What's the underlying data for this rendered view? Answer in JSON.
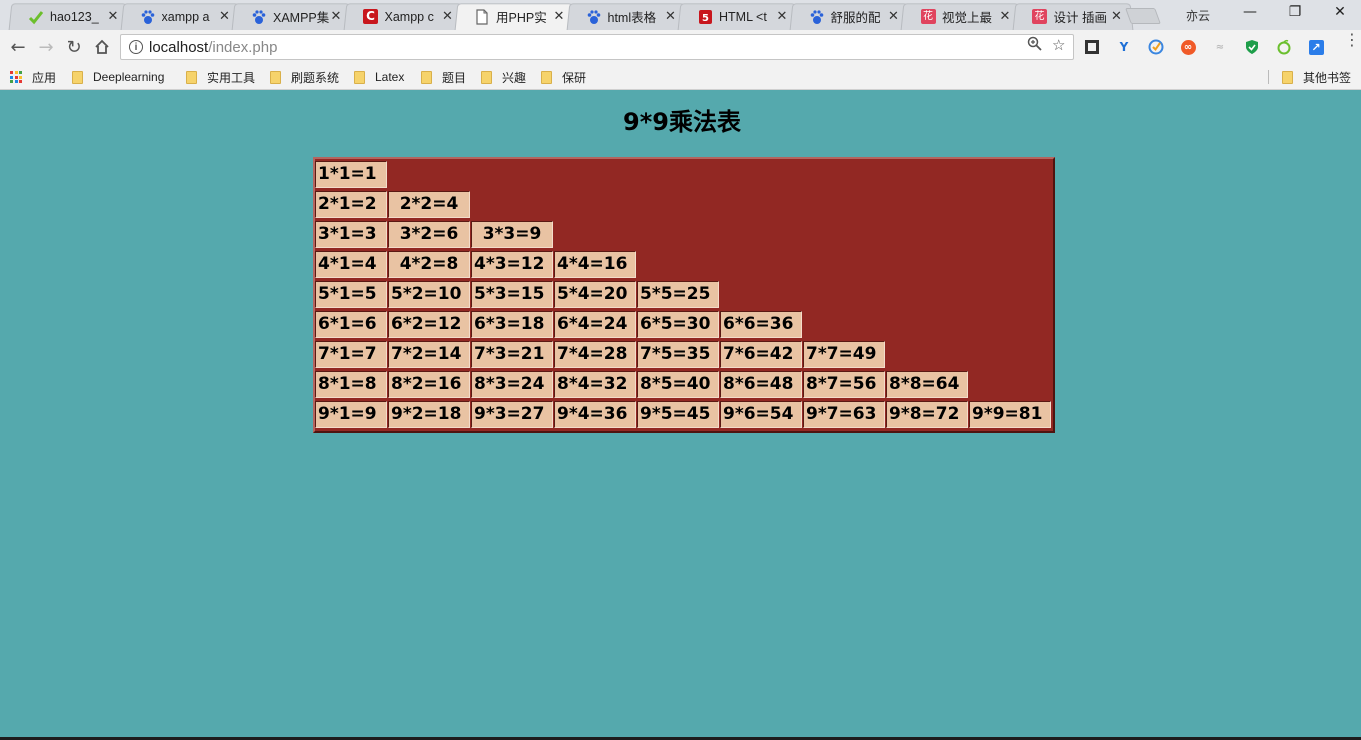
{
  "browser": {
    "tabs": [
      {
        "title": "hao123_",
        "icon": "hao123-icon",
        "active": false
      },
      {
        "title": "xampp a",
        "icon": "baidu-paw-icon",
        "active": false
      },
      {
        "title": "XAMPP集",
        "icon": "baidu-paw-icon",
        "active": false
      },
      {
        "title": "Xampp c",
        "icon": "c-logo-icon",
        "active": false
      },
      {
        "title": "用PHP实",
        "icon": "page-icon",
        "active": true
      },
      {
        "title": "html表格",
        "icon": "baidu-paw-icon",
        "active": false
      },
      {
        "title": "HTML <t",
        "icon": "html-shield-icon",
        "active": false
      },
      {
        "title": "舒服的配",
        "icon": "baidu-paw-icon",
        "active": false
      },
      {
        "title": "视觉上最",
        "icon": "huaban-icon",
        "active": false
      },
      {
        "title": "设计 插画",
        "icon": "huaban-icon",
        "active": false
      }
    ],
    "close_glyph": "✕",
    "profile_name": "亦云",
    "window_controls": {
      "minimize": "—",
      "restore": "❐",
      "close": "✕"
    },
    "address": {
      "host": "localhost",
      "path": "/index.php"
    },
    "bookmarks": [
      {
        "label": "应用",
        "icon": "apps-grid-icon"
      },
      {
        "label": "Deeplearning",
        "icon": "folder-icon"
      },
      {
        "label": "实用工具",
        "icon": "folder-icon"
      },
      {
        "label": "刷题系统",
        "icon": "folder-icon"
      },
      {
        "label": "Latex",
        "icon": "folder-icon"
      },
      {
        "label": "题目",
        "icon": "folder-icon"
      },
      {
        "label": "兴趣",
        "icon": "folder-icon"
      },
      {
        "label": "保研",
        "icon": "folder-icon"
      }
    ],
    "other_bookmarks": "其他书签",
    "colors": {
      "page_bg": "#55a9ad",
      "table_bg": "#922823",
      "cell_bg": "#e9c3a3"
    }
  },
  "page": {
    "title": "9*9乘法表",
    "rows": [
      [
        "1*1=1"
      ],
      [
        "2*1=2",
        "2*2=4"
      ],
      [
        "3*1=3",
        "3*2=6",
        "3*3=9"
      ],
      [
        "4*1=4",
        "4*2=8",
        "4*3=12",
        "4*4=16"
      ],
      [
        "5*1=5",
        "5*2=10",
        "5*3=15",
        "5*4=20",
        "5*5=25"
      ],
      [
        "6*1=6",
        "6*2=12",
        "6*3=18",
        "6*4=24",
        "6*5=30",
        "6*6=36"
      ],
      [
        "7*1=7",
        "7*2=14",
        "7*3=21",
        "7*4=28",
        "7*5=35",
        "7*6=42",
        "7*7=49"
      ],
      [
        "8*1=8",
        "8*2=16",
        "8*3=24",
        "8*4=32",
        "8*5=40",
        "8*6=48",
        "8*7=56",
        "8*8=64"
      ],
      [
        "9*1=9",
        "9*2=18",
        "9*3=27",
        "9*4=36",
        "9*5=45",
        "9*6=54",
        "9*7=63",
        "9*8=72",
        "9*9=81"
      ]
    ]
  }
}
